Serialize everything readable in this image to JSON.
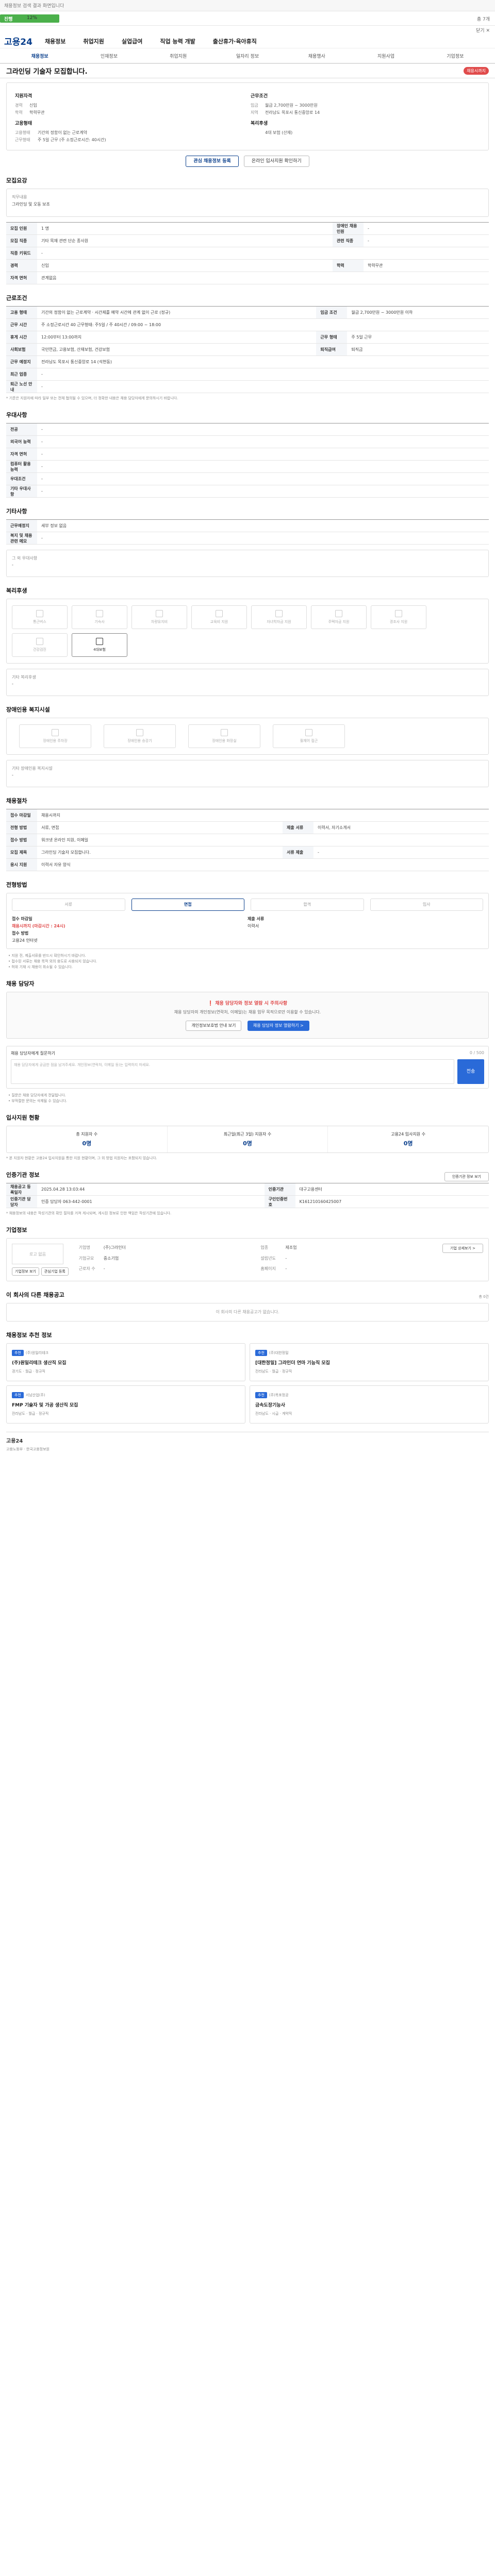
{
  "top": {
    "banner": "채용정보 검색 결과 화면입니다",
    "progress_label": "진행",
    "progress_pct": 12,
    "progress_text": "12%",
    "total_text": "총 7개",
    "close_label": "닫기 ✕"
  },
  "header": {
    "logo": "고용24",
    "gnb": [
      "채용정보",
      "취업지원",
      "실업급여",
      "직업 능력 개발",
      "출산휴가·육아휴직"
    ]
  },
  "subnav": [
    "채용정보",
    "인재정보",
    "취업지원",
    "일자리 정보",
    "채용행사",
    "지원사업",
    "기업정보"
  ],
  "title": {
    "text": "그라인딩 기술자 모집합니다.",
    "badge": "채용시까지"
  },
  "summary": {
    "left": {
      "label": "지원자격",
      "rows": [
        {
          "k": "경력",
          "v": "신입"
        },
        {
          "k": "학력",
          "v": "학력무관"
        }
      ]
    },
    "right": {
      "label": "근무조건",
      "rows": [
        {
          "k": "임금",
          "v": "월급 2,700만원 ~ 3000만원"
        },
        {
          "k": "지역",
          "v": "전라남도 목포시 통신중앙로 14"
        }
      ]
    },
    "left2": {
      "label": "고용형태",
      "rows": [
        {
          "k": "고용형태",
          "v": "기간의 정함이 없는 근로계약"
        },
        {
          "k": "근무형태",
          "v": "주 5일 근무 (주 소정근로시간: 40시간)"
        }
      ]
    },
    "right2": {
      "label": "복리후생",
      "rows": [
        {
          "k": "",
          "v": "4대 보험 (산재)"
        }
      ]
    }
  },
  "buttons": {
    "apply": "온라인 입사지원 확인하기",
    "save": "관심 채용정보 등록"
  },
  "sections": {
    "job": "모집요강",
    "cond": "근로조건",
    "prefer": "우대사항",
    "extra": "기타사항",
    "welfare": "복리후생",
    "disability": "장애인용 복지시설",
    "process": "채용절차",
    "progress": "전형방법",
    "contact": "채용 담당자",
    "applicants": "입사지원 현황",
    "agency": "인증기관 정보",
    "company": "기업정보",
    "same": "이 회사의 다른 채용공고",
    "recommend": "채용정보 추천 정보"
  },
  "job": {
    "k1": "직무내용",
    "v1": "그라인딩 및 오동 보조"
  },
  "job_table": [
    [
      "모집 인원",
      "1 명",
      "장애인 채용 인원",
      "-"
    ],
    [
      "모집 직종",
      "기타 목재 관련 단순 종사원",
      "관련 직종",
      "-"
    ],
    [
      "직종 키워드",
      "-",
      "",
      ""
    ],
    [
      "경력",
      "신입",
      "학력",
      "학력무관"
    ],
    [
      "자격 면허",
      "관계없음",
      "",
      ""
    ]
  ],
  "cond_table": [
    [
      "고용 형태",
      "기간의 정함이 없는 근로계약 · 시간제를 예약 시간에 관계 없이 근로 (정규)",
      "임금 조건",
      "월급 2,700만원 ~ 3000만원 이하"
    ],
    [
      "근무 시간",
      "주 소정근로시간 40\n근무형태: 주5일 / 주 40시간 / 09:00 ~ 18:00",
      "",
      ""
    ],
    [
      "휴게 시간",
      "12:00부터 13:00까지",
      "근무 형태",
      "주 5일 근무"
    ],
    [
      "사회보험",
      "국민연금, 고용보험, 산재보험, 건강보험",
      "퇴직급여",
      "퇴직금"
    ],
    [
      "근무 예정지",
      "전라남도 목포시 통신중앙로 14 (석현동)",
      "",
      ""
    ],
    [
      "최근 업종",
      "-",
      "",
      ""
    ],
    [
      "퇴근 노선 안내",
      "-",
      "",
      ""
    ]
  ],
  "cond_note": "* 기준은 지원자에 따라 일부 또는 전체 협의될 수 있으며, 더 정확한 내용은 채용 담당자에게 문의하시기 바랍니다.",
  "prefer_table": [
    [
      "전공",
      "-"
    ],
    [
      "외국어 능력",
      "-"
    ],
    [
      "자격 면허",
      "-"
    ],
    [
      "컴퓨터 활용 능력",
      "-"
    ],
    [
      "우대조건",
      "-"
    ],
    [
      "기타 우대사항",
      "-"
    ]
  ],
  "extra_table": [
    [
      "근무예정지",
      "세부 정보 없음"
    ],
    [
      "복지 및 채용 관련 메모",
      "-"
    ]
  ],
  "extra_misc": {
    "k": "그 외 우대사항",
    "v": "-"
  },
  "welfare_tiles": [
    {
      "label": "통근버스",
      "on": false
    },
    {
      "label": "기숙사",
      "on": false
    },
    {
      "label": "차량유지비",
      "on": false
    },
    {
      "label": "교육비 지원",
      "on": false
    },
    {
      "label": "자녀학자금 지원",
      "on": false
    },
    {
      "label": "주택자금 지원",
      "on": false
    },
    {
      "label": "경조사 지원",
      "on": false
    },
    {
      "label": "건강검진",
      "on": false
    },
    {
      "label": "4대보험",
      "on": true
    }
  ],
  "welfare_other": {
    "k": "기타 복리후생",
    "v": "-"
  },
  "disability_tiles": [
    {
      "label": "장애인용 주차장"
    },
    {
      "label": "장애인용 승강기"
    },
    {
      "label": "장애인용 화장실"
    },
    {
      "label": "휠체어 접근"
    }
  ],
  "disability_other": {
    "k": "기타 장애인용 복지시설",
    "v": "-"
  },
  "process_table": [
    [
      "접수 마감일",
      "채용시까지",
      "",
      ""
    ],
    [
      "전형 방법",
      "서류, 면접",
      "제출 서류",
      "이력서, 자기소개서"
    ],
    [
      "접수 방법",
      "워크넷 온라인 지원, 이메일",
      "",
      ""
    ],
    [
      "모집 제목",
      "그라인딩 기술자 모집합니다.",
      "서류 제출",
      "-"
    ],
    [
      "응시 지원",
      "이력서 자유 양식",
      "",
      ""
    ]
  ],
  "steps": [
    "서류",
    "면접",
    "합격",
    "입사"
  ],
  "step_on": 1,
  "pinfo": [
    {
      "t": "접수 마감일",
      "v": "채용시까지 (마감시간 : 24시)",
      "red": true
    },
    {
      "t": "접수 방법",
      "v": "고용24 인터넷"
    }
  ],
  "pinfo2": {
    "t": "제출 서류",
    "v": "이력서"
  },
  "bullets": [
    "• 지원 전, 제출서류를 반드시 확인하시기 바랍니다.",
    "• 접수된 서류는 채용 목적 외의 용도로 사용되지 않습니다.",
    "• 허위 기재 시 채용이 취소될 수 있습니다."
  ],
  "contact": {
    "alert_title": "❗ 채용 담당자와 정보 열람 시 주의사항",
    "alert_desc": "채용 담당자의 개인정보(연락처, 이메일)는 채용 업무 목적으로만 이용할 수 있습니다.",
    "btn1": "개인정보보호법 안내 보기",
    "btn2": "채용 담당자 정보 열람하기 >",
    "q_label": "채용 담당자에게 질문하기",
    "q_count": "0 / 500",
    "q_placeholder": "채용 담당자에게 궁금한 점을 남겨주세요. 개인정보(연락처, 이메일 등)는 입력하지 마세요.",
    "q_send": "전송",
    "notes": [
      "• 질문은 채용 담당자에게 전달됩니다.",
      "• 부적절한 문의는 삭제될 수 있습니다."
    ]
  },
  "applicants": [
    {
      "k": "총 지원자 수",
      "v": "0명"
    },
    {
      "k": "최근일(최근 3일) 지원자 수",
      "v": "0명"
    },
    {
      "k": "고용24 입사지원 수",
      "v": "0명"
    }
  ],
  "applicants_note": "* 본 지원자 현황은 고용24 입사지원을 통한 지원 현황이며, 그 외 방법 지원자는 포함되지 않습니다.",
  "agency_btn": "인증기관 정보 보기",
  "agency_table": [
    [
      "채용공고 등록일자",
      "2025.04.28 13:03:44",
      "인증기관",
      "대구고용센터"
    ],
    [
      "인증기관 담당자",
      "인증 담당자 063-442-0001",
      "구인인증번호",
      "K161210160425007"
    ]
  ],
  "agency_note": "* 채용정보의 내용은 작성기관의 확인 절차를 거쳐 게시되며, 게시된 정보로 인한 책임은 작성기관에 있습니다.",
  "company": {
    "logo": "로고 없음",
    "name": "(주)그라인더",
    "rows": [
      {
        "k": "기업명",
        "v": "(주)그라인더"
      },
      {
        "k": "업종",
        "v": "제조업"
      },
      {
        "k": "기업규모",
        "v": "중소기업"
      },
      {
        "k": "설립년도",
        "v": "-"
      },
      {
        "k": "근로자 수",
        "v": "-"
      },
      {
        "k": "홈페이지",
        "v": "-"
      }
    ],
    "btn1": "기업정보 보기",
    "btn2": "관심기업 등록",
    "more": "기업 상세보기 >"
  },
  "same": {
    "empty": "이 회사의 다른 채용공고가 없습니다.",
    "more": "총 0건"
  },
  "recommends": [
    {
      "tag": "추천",
      "org": "(주)원일리테크",
      "title": "(주)원일리테크 생산직 모집",
      "meta": "경기도 · 월급 · 정규직"
    },
    {
      "tag": "추천",
      "org": "(주)대한정밀",
      "title": "[대한정밀] 그라인더 연마 기능직 모집",
      "meta": "전라남도 · 월급 · 정규직"
    },
    {
      "tag": "추천",
      "org": "서남산업(주)",
      "title": "FMP 기술자 및 가공 생산직 모집",
      "meta": "전라남도 · 월급 · 정규직"
    },
    {
      "tag": "추천",
      "org": "(주)목포정공",
      "title": "금속도장기능사",
      "meta": "전라남도 · 시급 · 계약직"
    }
  ],
  "footer": {
    "left": "고용24",
    "right": "고용노동부 · 한국고용정보원"
  }
}
